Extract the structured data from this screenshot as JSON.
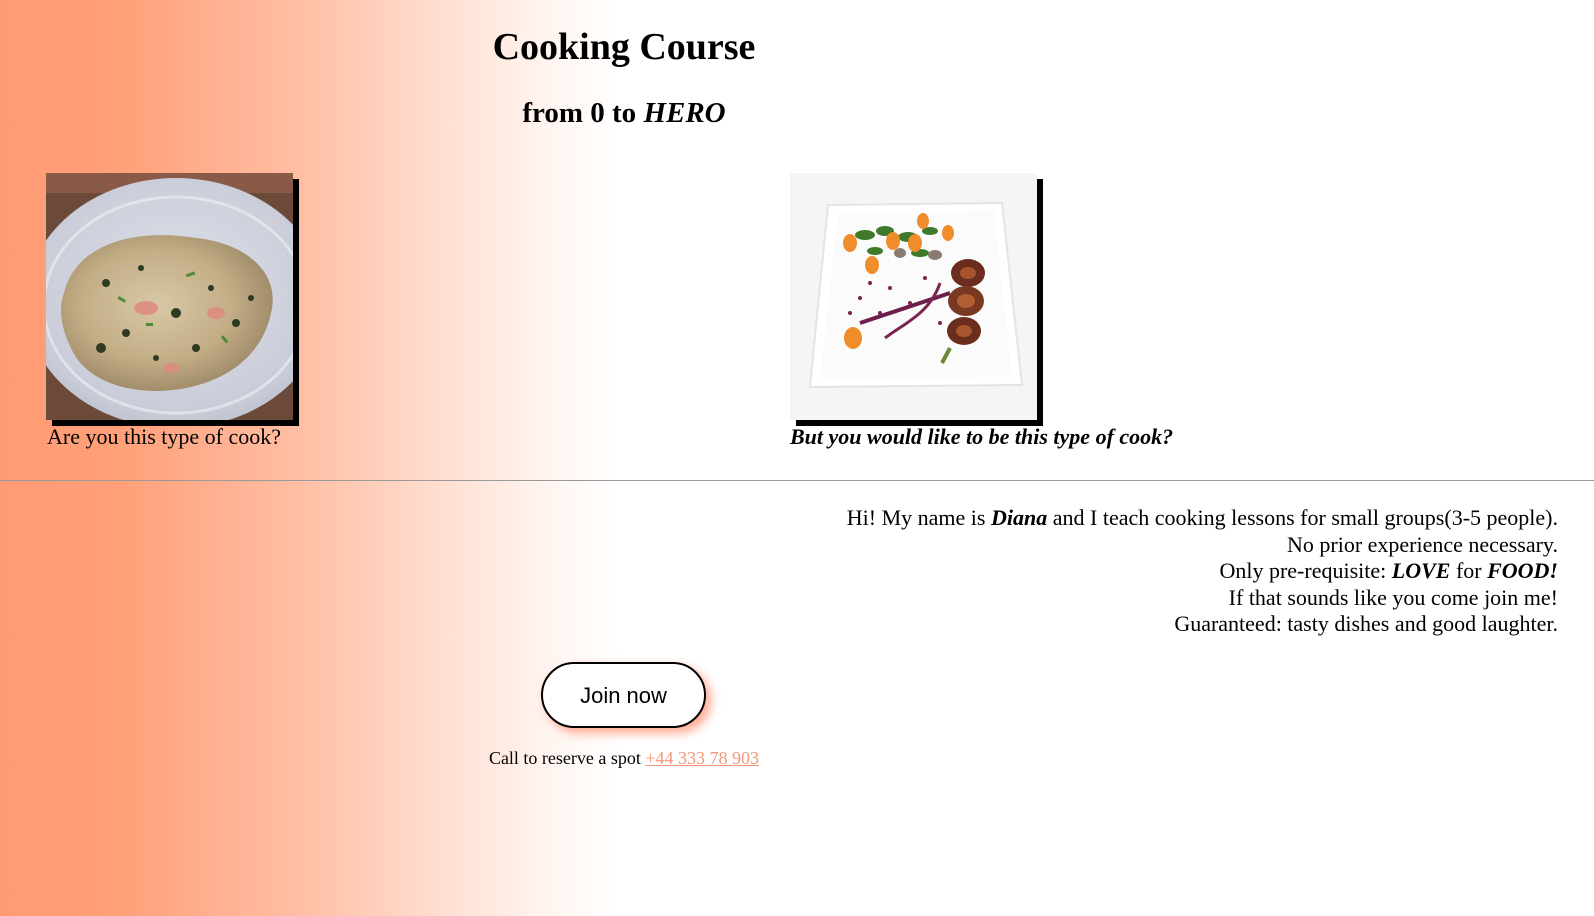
{
  "header": {
    "title": "Cooking Course",
    "subtitle_prefix": "from 0 to ",
    "subtitle_emphasis": "HERO"
  },
  "gallery": {
    "left": {
      "image_alt": "omelette-on-plate",
      "caption": "Are you this type of cook?"
    },
    "right": {
      "image_alt": "gourmet-plated-dish",
      "caption": "But you would like to be this type of cook?"
    }
  },
  "intro": {
    "line1_prefix": "Hi! My name is ",
    "line1_name": "Diana",
    "line1_suffix": " and I teach cooking lessons for small groups(3-5 people).",
    "line2": "No prior experience necessary.",
    "line3_prefix": "Only pre-requisite: ",
    "line3_love": "LOVE",
    "line3_mid": " for ",
    "line3_food": "FOOD!",
    "line4": "If that sounds like you come join me!",
    "line5": "Guaranteed: tasty dishes and good laughter."
  },
  "cta": {
    "button_label": "Join now",
    "call_text": "Call to reserve a spot ",
    "phone": "+44 333 78 903"
  },
  "colors": {
    "gradient_start": "#ff9b74",
    "link": "#f4977a",
    "button_shadow": "#ff8c69"
  }
}
